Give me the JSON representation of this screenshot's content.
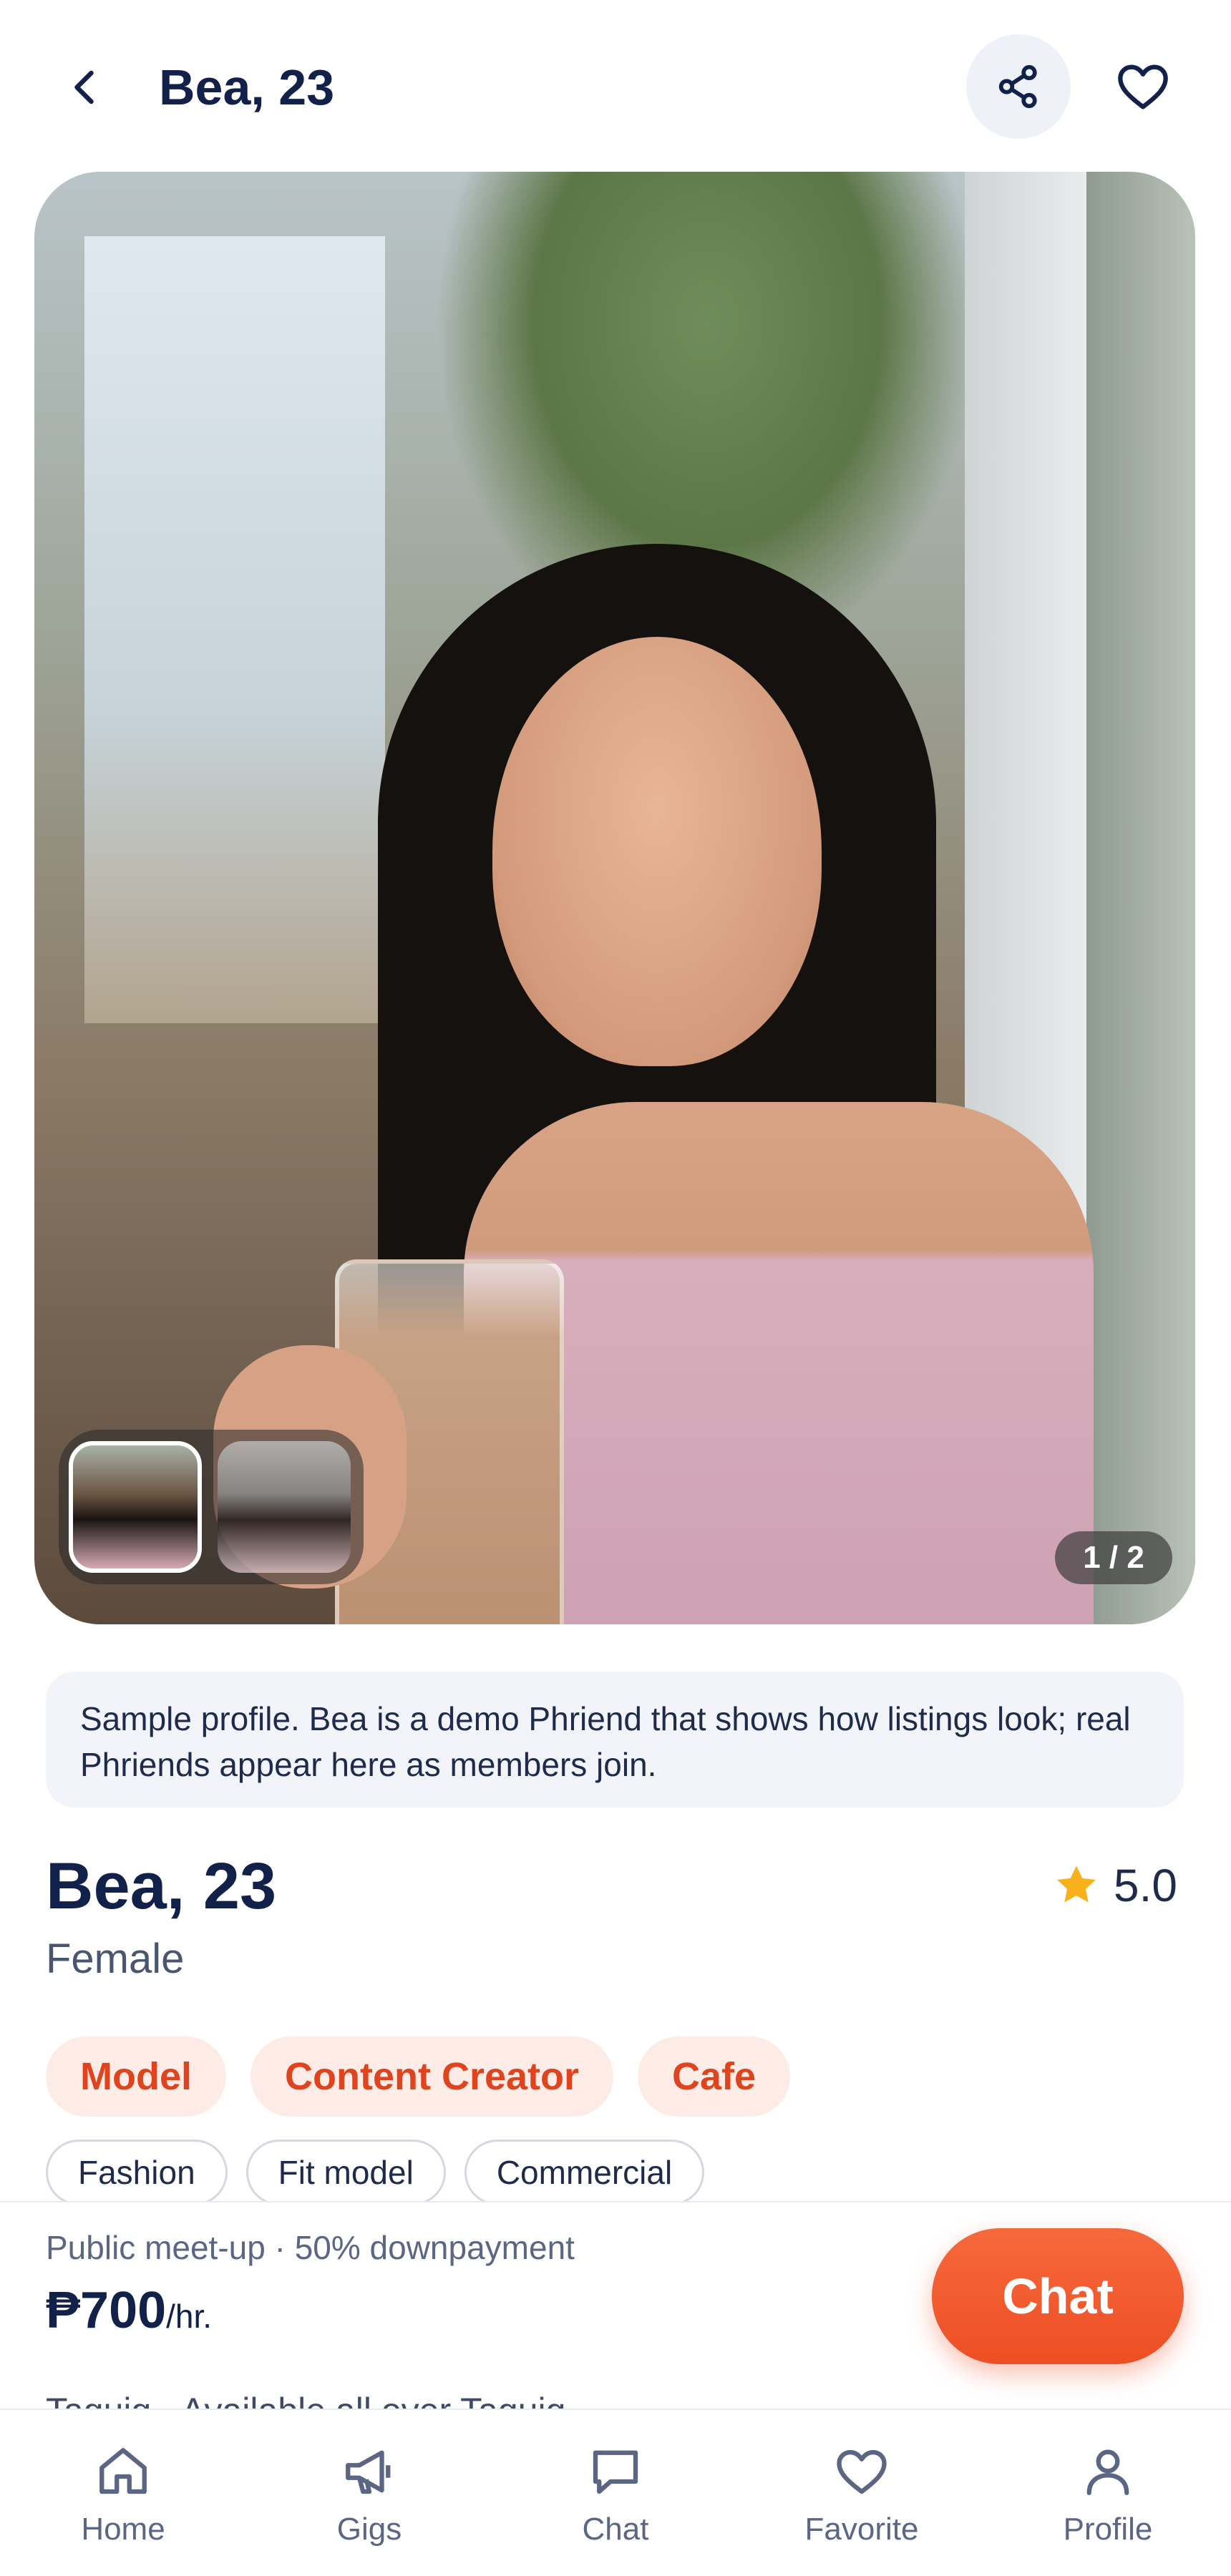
{
  "header": {
    "title": "Bea, 23"
  },
  "gallery": {
    "counter": "1 / 2"
  },
  "notice": "Sample profile. Bea is a demo Phriend that shows how listings look; real Phriends appear here as members join.",
  "profile": {
    "name": "Bea, 23",
    "gender": "Female",
    "rating": "5.0",
    "primary_tags": [
      "Model",
      "Content Creator",
      "Cafe"
    ],
    "secondary_tags": [
      "Fashion",
      "Fit model",
      "Commercial"
    ]
  },
  "booking": {
    "subtitle": "Public meet-up · 50% downpayment",
    "price": "₱700",
    "price_unit": "/hr.",
    "chat_label": "Chat",
    "peek_text": "Taguig · Available all over Taguig"
  },
  "tabbar": {
    "items": [
      {
        "label": "Home",
        "icon": "home-icon"
      },
      {
        "label": "Gigs",
        "icon": "megaphone-icon"
      },
      {
        "label": "Chat",
        "icon": "chat-bubble-icon"
      },
      {
        "label": "Favorite",
        "icon": "heart-icon"
      },
      {
        "label": "Profile",
        "icon": "person-icon"
      }
    ]
  },
  "colors": {
    "accent": "#ee4e24",
    "navy": "#12214a",
    "chip_bg": "#fdece6",
    "star": "#f9b11b"
  }
}
